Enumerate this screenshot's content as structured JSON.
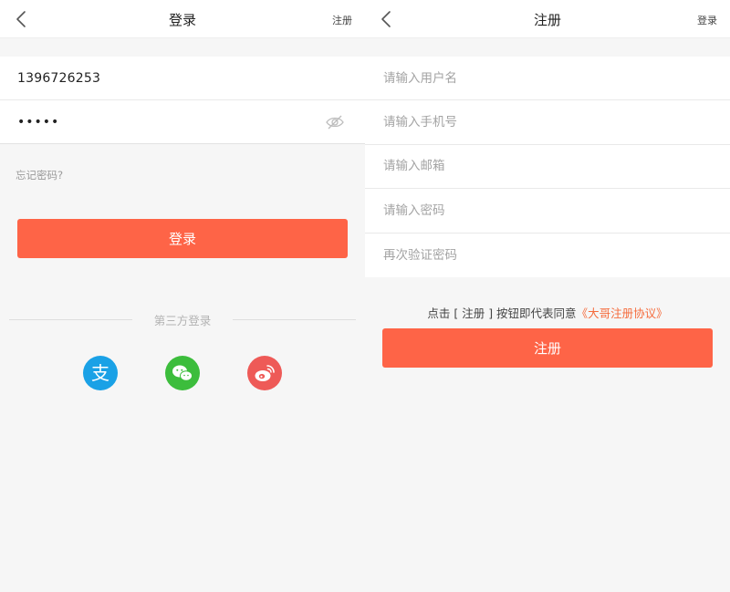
{
  "login": {
    "header": {
      "title": "登录",
      "right_link": "注册"
    },
    "phone_value": "1396726253",
    "password_mask": "•••••",
    "forgot_password": "忘记密码?",
    "login_button": "登录",
    "third_party_label": "第三方登录",
    "social": [
      {
        "name": "alipay",
        "color": "#1aa1e6",
        "glyph": "支"
      },
      {
        "name": "wechat",
        "color": "#3cbd3c"
      },
      {
        "name": "weibo",
        "color": "#ee5a57"
      }
    ]
  },
  "register": {
    "header": {
      "title": "注册",
      "right_link": "登录"
    },
    "fields": [
      {
        "placeholder": "请输入用户名"
      },
      {
        "placeholder": "请输入手机号"
      },
      {
        "placeholder": "请输入邮箱"
      },
      {
        "placeholder": "请输入密码"
      },
      {
        "placeholder": "再次验证密码"
      }
    ],
    "agreement_prefix": "点击 [ 注册 ] 按钮即代表同意",
    "agreement_link": "《大哥注册协议》",
    "register_button": "注册"
  },
  "colors": {
    "accent": "#fe6447",
    "link": "#f56c3d"
  }
}
